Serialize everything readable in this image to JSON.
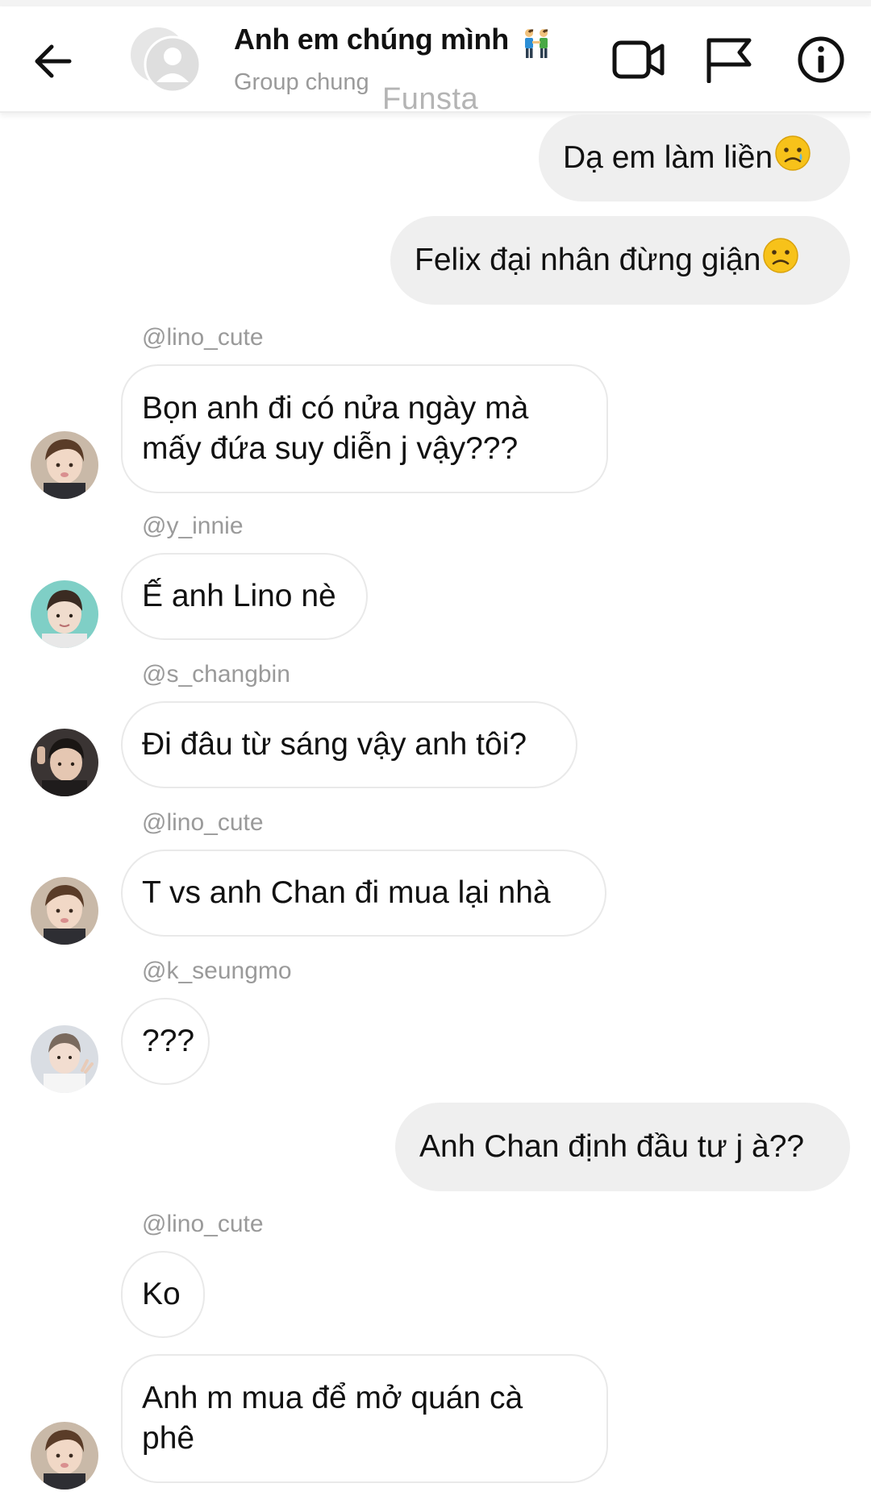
{
  "header": {
    "title": "Anh em chúng mình",
    "subtitle": "Group chung",
    "watermark": "Funsta"
  },
  "icons": {
    "back": "arrow-left-icon",
    "group": "group-avatar-icon",
    "title_emoji": "two-men-holding-hands-icon",
    "video": "video-camera-icon",
    "flag": "flag-icon",
    "info": "info-icon"
  },
  "messages": [
    {
      "type": "outgoing",
      "text": "Dạ em làm liền",
      "emoji": "sad-tear-face"
    },
    {
      "type": "outgoing",
      "text": "Felix đại nhân đừng giận",
      "emoji": "frowning-face"
    },
    {
      "type": "incoming",
      "sender": "@lino_cute",
      "lines": [
        "Bọn anh đi có nửa ngày mà",
        "mấy đứa suy diễn j vậy???"
      ]
    },
    {
      "type": "incoming",
      "sender": "@y_innie",
      "text": "Ế anh Lino nè"
    },
    {
      "type": "incoming",
      "sender": "@s_changbin",
      "text": "Đi đâu từ sáng vậy anh tôi?"
    },
    {
      "type": "incoming",
      "sender": "@lino_cute",
      "text": "T vs anh Chan đi mua lại nhà"
    },
    {
      "type": "incoming",
      "sender": "@k_seungmo",
      "text": "???"
    },
    {
      "type": "outgoing",
      "text": "Anh Chan định đầu tư j à??"
    },
    {
      "type": "incoming",
      "sender": "@lino_cute",
      "text": "Ko"
    },
    {
      "type": "incoming",
      "lines": [
        "Anh m mua để mở quán cà",
        "phê"
      ]
    }
  ],
  "colors": {
    "outgoing_bubble": "#efefef",
    "incoming_border": "#e9e9e9",
    "muted_text": "#9a9a9a",
    "emoji_yellow": "#f7c21a"
  }
}
